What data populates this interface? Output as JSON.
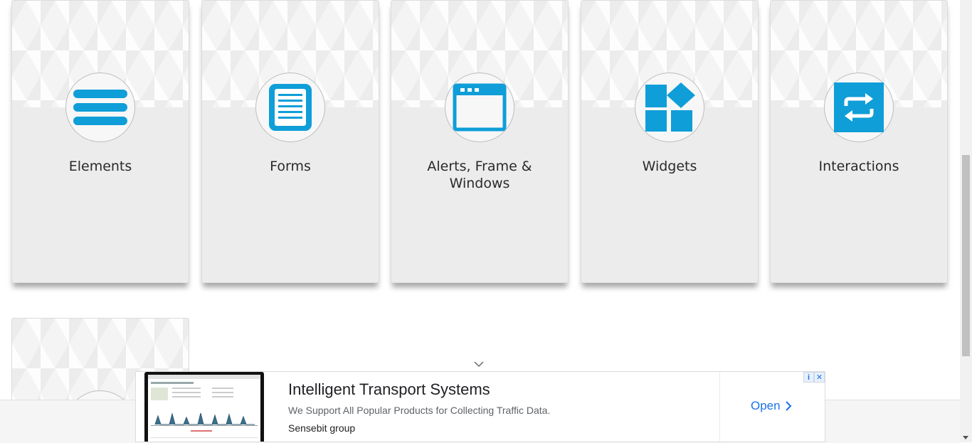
{
  "cards": [
    {
      "title": "Elements",
      "icon": "hamburger-list-icon"
    },
    {
      "title": "Forms",
      "icon": "document-form-icon"
    },
    {
      "title": "Alerts, Frame &",
      "title2": "Windows",
      "icon": "browser-window-icon"
    },
    {
      "title": "Widgets",
      "icon": "widgets-blocks-icon"
    },
    {
      "title": "Interactions",
      "icon": "swap-arrows-icon"
    }
  ],
  "colors": {
    "accent": "#0f9ed8",
    "card_bg": "#ececec"
  },
  "ad": {
    "headline": "Intelligent Transport Systems",
    "description": "We Support All Popular Products for Collecting Traffic Data.",
    "brand": "Sensebit group",
    "cta": "Open",
    "info_icon": "info-icon",
    "close_icon": "close-icon"
  }
}
